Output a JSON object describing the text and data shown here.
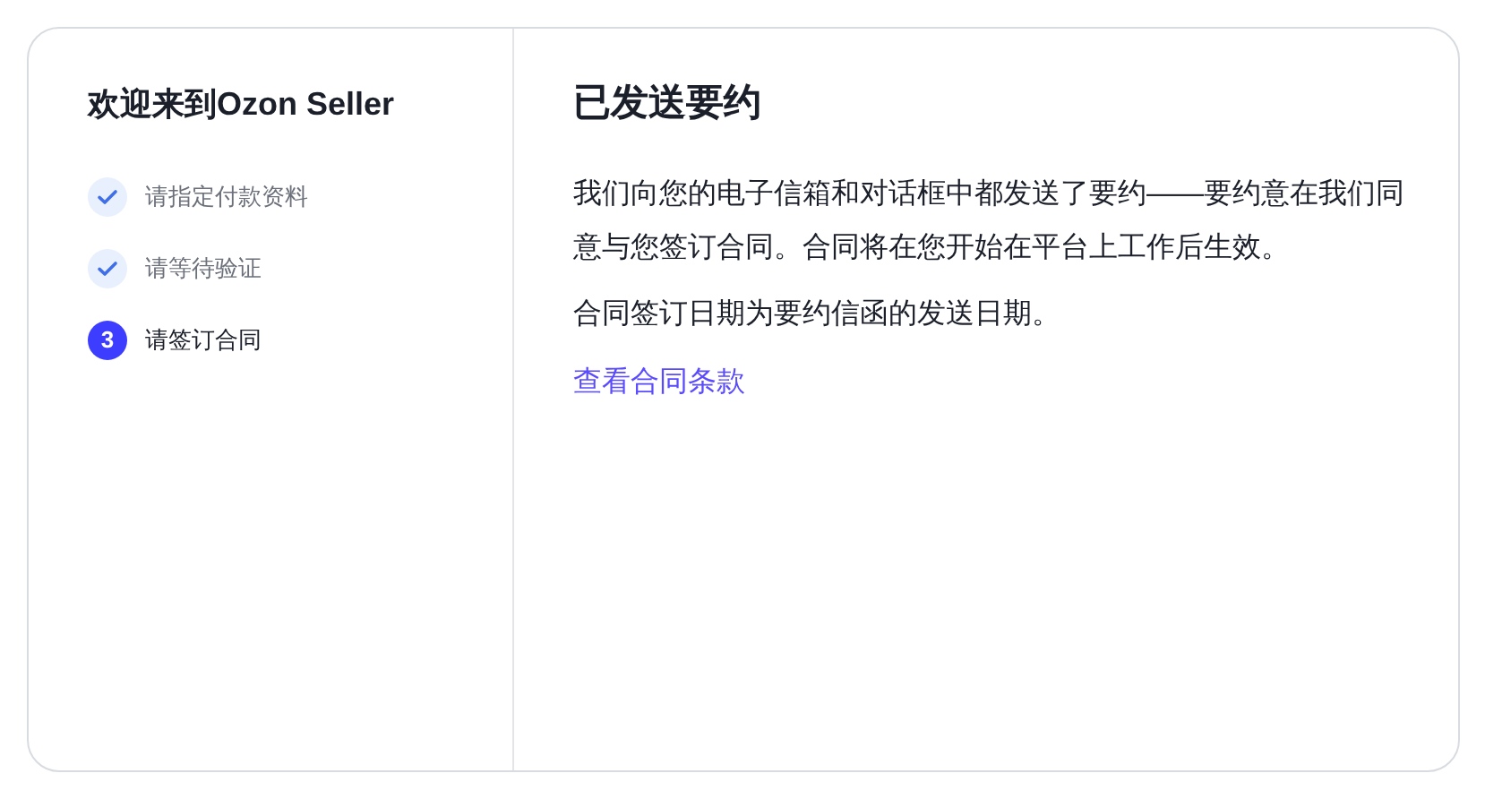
{
  "sidebar": {
    "title": "欢迎来到Ozon Seller",
    "steps": [
      {
        "label": "请指定付款资料",
        "completed": true
      },
      {
        "label": "请等待验证",
        "completed": true
      },
      {
        "label": "请签订合同",
        "completed": false,
        "number": "3"
      }
    ]
  },
  "main": {
    "title": "已发送要约",
    "paragraphs": [
      "我们向您的电子信箱和对话框中都发送了要约——要约意在我们同意与您签订合同。合同将在您开始在平台上工作后生效。",
      "合同签订日期为要约信函的发送日期。"
    ],
    "link": "查看合同条款"
  }
}
